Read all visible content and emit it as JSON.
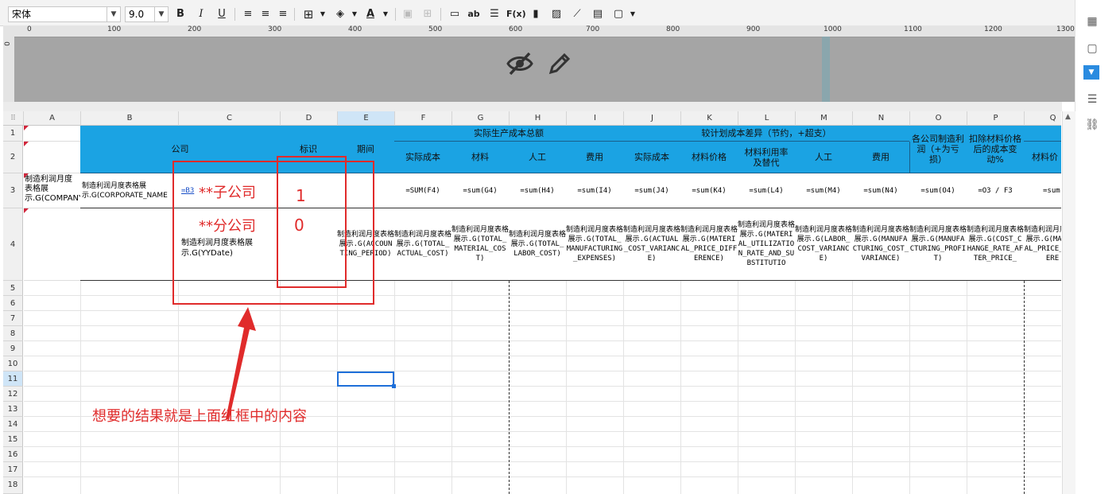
{
  "toolbar": {
    "font_name": "宋体",
    "font_size": "9.0",
    "bold": "B",
    "italic": "I",
    "underline": "U",
    "text_label": "ab",
    "fx_label": "F(x)",
    "font_color_label": "A"
  },
  "ruler": {
    "ticks": [
      "0",
      "100",
      "200",
      "300",
      "400",
      "500",
      "600",
      "700",
      "800",
      "900",
      "1000",
      "1100",
      "1200",
      "1300"
    ],
    "vertical_zero": "0"
  },
  "columns": [
    "A",
    "B",
    "C",
    "D",
    "E",
    "F",
    "G",
    "H",
    "I",
    "J",
    "K",
    "L",
    "M",
    "N",
    "O",
    "P",
    "Q"
  ],
  "rows": [
    "1",
    "2",
    "3",
    "4",
    "5",
    "6",
    "7",
    "8",
    "9",
    "10",
    "11",
    "12",
    "13",
    "14",
    "15",
    "16",
    "17",
    "18"
  ],
  "header": {
    "company": "公司",
    "flag": "标识",
    "period": "期间",
    "actual_total": "实际生产成本总额",
    "plan_diff": "较计划成本差异（节约，+超支）",
    "profit": "各公司制造利润（+为亏损）",
    "change": "扣除材料价格后的成本变动%",
    "actual_cost": "实际成本",
    "material": "材料",
    "labor": "人工",
    "expense": "费用",
    "actual_cost2": "实际成本",
    "material_price": "材料价格",
    "material_usage": "材料利用率及替代",
    "labor2": "人工",
    "expense2": "费用",
    "q_partial": "材料价"
  },
  "row3": {
    "a": "制造利润月度表格展示.G(COMPANY",
    "b": "制造利润月度表格展示.G(CORPORATE_NAME",
    "c_link": "=B3",
    "c_note": "**子公司",
    "d": "1",
    "f": "=SUM(F4)",
    "g": "=sum(G4)",
    "h": "=sum(H4)",
    "i": "=sum(I4)",
    "j": "=sum(J4)",
    "k": "=sum(K4)",
    "l": "=sum(L4)",
    "m": "=sum(M4)",
    "n": "=sum(N4)",
    "o": "=sum(O4)",
    "p": "=O3 / F3",
    "q": "=sum"
  },
  "row4": {
    "c_note": "**分公司",
    "c": "制造利润月度表格展示.G(YYDate)",
    "d": "0",
    "e": "制造利润月度表格展示.G(ACCOUNTING_PERIOD)",
    "f": "制造利润月度表格展示.G(TOTAL_ACTUAL_COST)",
    "g": "制造利润月度表格展示.G(TOTAL_MATERIAL_COST)",
    "h": "制造利润月度表格展示.G(TOTAL_LABOR_COST)",
    "i": "制造利润月度表格展示.G(TOTAL_MANUFACTURING_EXPENSES)",
    "j": "制造利润月度表格展示.G(ACTUAL_COST_VARIANCE)",
    "k": "制造利润月度表格展示.G(MATERIAL_PRICE_DIFFERENCE)",
    "l": "制造利润月度表格展示.G(MATERIAL_UTILIZATION_RATE_AND_SUBSTITUTIO",
    "m": "制造利润月度表格展示.G(LABOR_COST_VARIANCE)",
    "n": "制造利润月度表格展示.G(MANUFACTURING_COST_VARIANCE)",
    "o": "制造利润月度表格展示.G(MANUFACTURING_PROFIT)",
    "p": "制造利润月度表格展示.G(COST_CHANGE_RATE_AFTER_PRICE_",
    "q": "制造利润月度表格展示.G(MATERIAL_PRICE_DIFFERE"
  },
  "annotation": {
    "text": "想要的结果就是上面红框中的内容",
    "color": "#e02b2b"
  },
  "colors": {
    "header_blue": "#1ba3e3",
    "selection": "#1e6fd9"
  },
  "icons": {
    "hide": "eye-off-icon",
    "edit": "pencil-icon"
  }
}
